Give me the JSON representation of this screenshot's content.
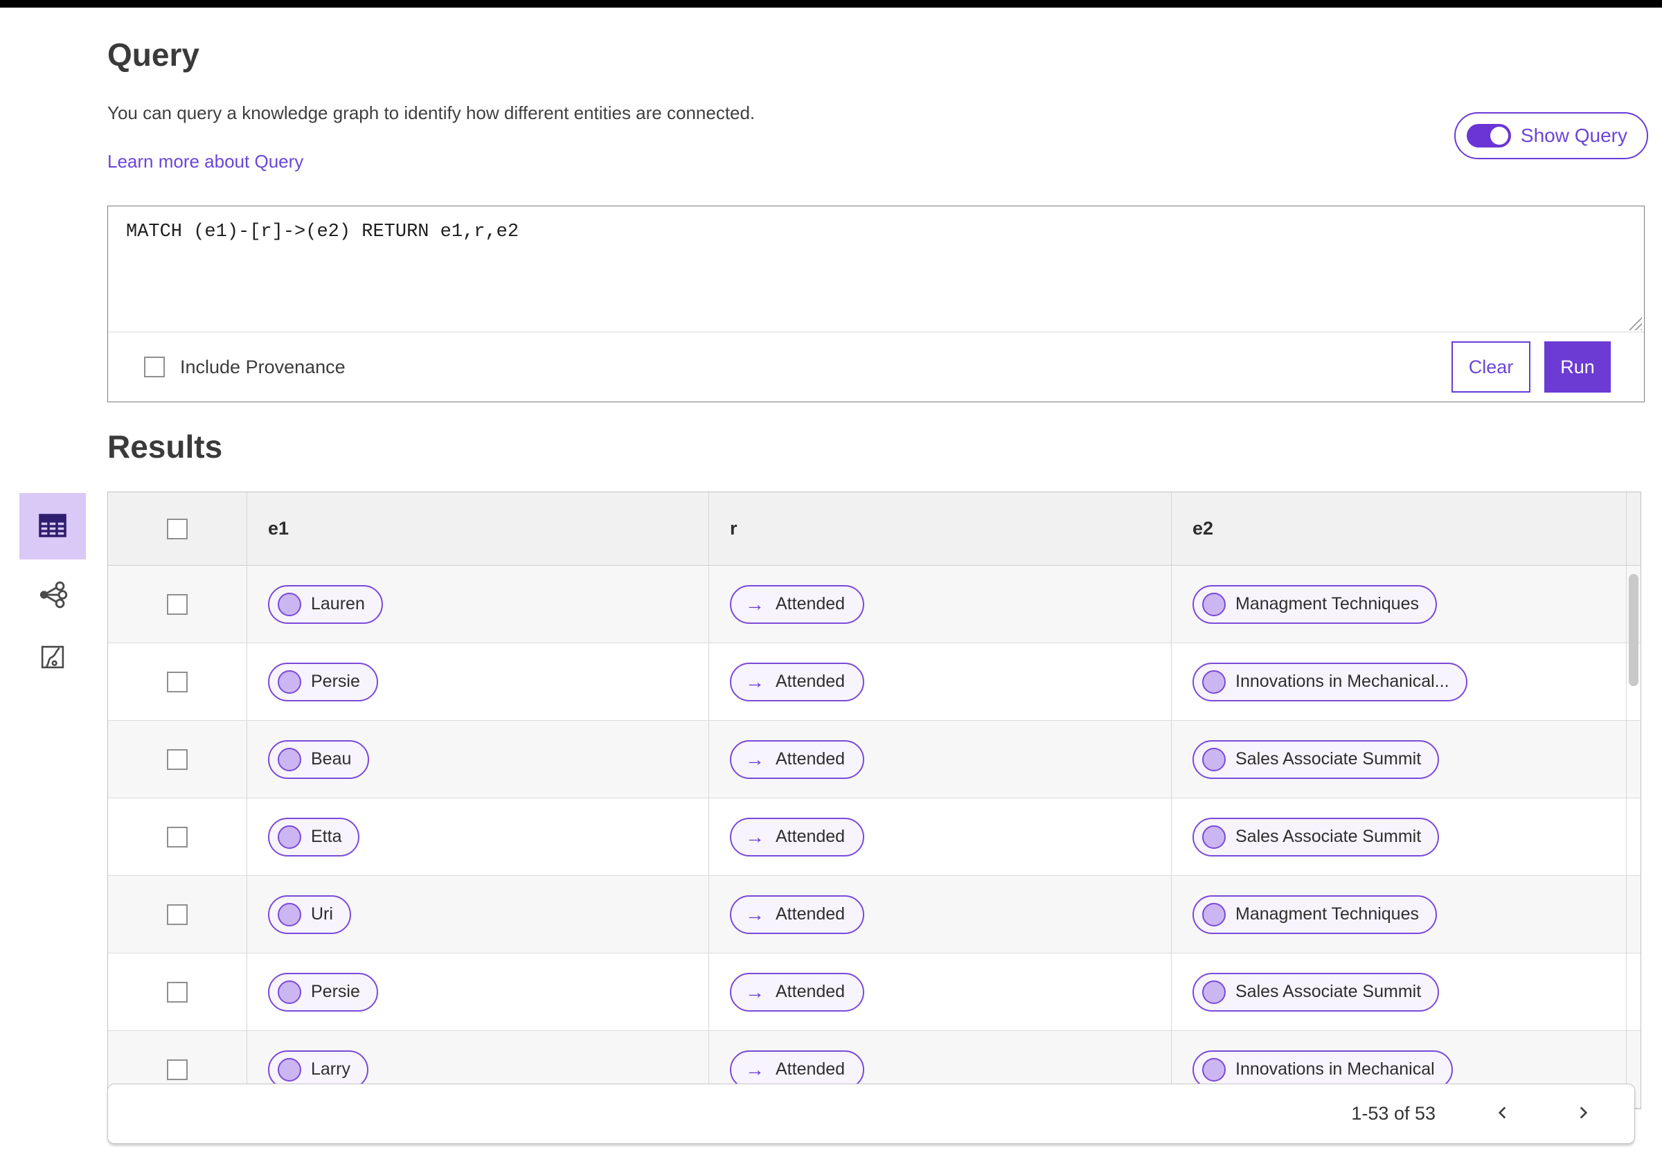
{
  "header": {
    "title": "Query",
    "description": "You can query a knowledge graph to identify how different entities are connected.",
    "learn_more_link": "Learn more about Query",
    "show_query_toggle": {
      "label": "Show Query",
      "state": "on"
    }
  },
  "query_editor": {
    "query_text": "MATCH (e1)-[r]->(e2) RETURN e1,r,e2",
    "include_provenance": {
      "label": "Include Provenance",
      "checked": false
    },
    "buttons": {
      "clear": "Clear",
      "run": "Run"
    }
  },
  "results": {
    "heading": "Results",
    "view_switcher": [
      {
        "name": "table-view",
        "active": true
      },
      {
        "name": "graph-view",
        "active": false
      },
      {
        "name": "chart-view",
        "active": false
      }
    ],
    "table": {
      "columns": [
        "e1",
        "r",
        "e2"
      ],
      "rows": [
        {
          "e1": "Lauren",
          "r": "Attended",
          "e2": "Managment Techniques"
        },
        {
          "e1": "Persie",
          "r": "Attended",
          "e2": "Innovations in Mechanical..."
        },
        {
          "e1": "Beau",
          "r": "Attended",
          "e2": "Sales Associate Summit"
        },
        {
          "e1": "Etta",
          "r": "Attended",
          "e2": "Sales Associate Summit"
        },
        {
          "e1": "Uri",
          "r": "Attended",
          "e2": "Managment Techniques"
        },
        {
          "e1": "Persie",
          "r": "Attended",
          "e2": "Sales Associate Summit"
        },
        {
          "e1": "Larry",
          "r": "Attended",
          "e2": "Innovations in Mechanical"
        }
      ]
    },
    "pagination": {
      "range_label": "1-53 of 53"
    }
  },
  "icons": {
    "arrow_right": "→"
  },
  "colors": {
    "accent_purple": "#6a3bd8",
    "active_view_bg": "#d9c9f6",
    "row_alt": "#f7f7f7"
  }
}
